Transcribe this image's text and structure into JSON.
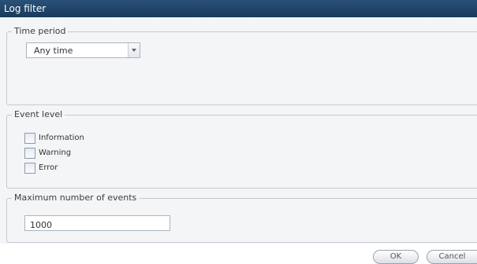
{
  "window": {
    "title": "Log filter"
  },
  "time_period": {
    "legend": "Time period",
    "selected": "Any time"
  },
  "event_level": {
    "legend": "Event level",
    "options": [
      {
        "label": "Information",
        "checked": false
      },
      {
        "label": "Warning",
        "checked": false
      },
      {
        "label": "Error",
        "checked": false
      }
    ]
  },
  "max_events": {
    "legend": "Maximum number of events",
    "value": "1000"
  },
  "buttons": {
    "ok": "OK",
    "cancel": "Cancel"
  },
  "colors": {
    "titlebar": "#1f4468",
    "panel": "#f4f5f7",
    "border": "#c4cad4"
  },
  "icons": {
    "dropdown": "chevron-down-icon"
  }
}
